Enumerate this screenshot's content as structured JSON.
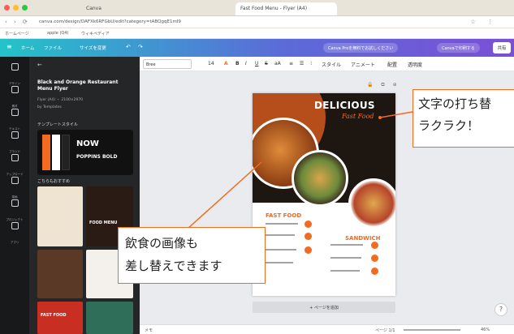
{
  "browser": {
    "tabs": [
      {
        "label": "Canva"
      },
      {
        "label": "Fast Food Menu - Flyer (A4)"
      }
    ],
    "url": "canva.com/design/DAFXk6RFGbU/edit?category=tABQgqE1mI9",
    "bookmarks": [
      "ホームページ",
      "apple (Q4)",
      "ウィキペディア"
    ]
  },
  "header": {
    "items": [
      "ホーム",
      "ファイル",
      "サイズを変更"
    ],
    "right_pills": [
      "Canva Proを無料でお試しください",
      "Canvaで印刷する"
    ],
    "share_label": "共有"
  },
  "toolbar": {
    "font": "Bree",
    "font_size": "14",
    "items": [
      "B",
      "I",
      "U",
      "S",
      "aA",
      "スタイル",
      "アニメート",
      "配置",
      "透明度"
    ]
  },
  "rail": {
    "items": [
      "デザイン",
      "素材",
      "テキスト",
      "ブランド",
      "アップロード",
      "描画",
      "プロジェクト",
      "アプリ"
    ]
  },
  "panel": {
    "back": "←",
    "title": "Black and Orange Restaurant Menu Flyer",
    "meta": "Flyer (A4) ・ 2100×2970",
    "by": "by Templates",
    "style_header": "テンプレートスタイル",
    "style_name": "NOW",
    "style_font": "POPPINS BOLD",
    "more_header": "こちらもおすすめ",
    "thumb_texts": [
      "FOOD MENU",
      "FAST FOOD"
    ]
  },
  "poster": {
    "headline": "DELICIOUS",
    "script": "Fast Food",
    "fast_food": "FAST FOOD",
    "sandwich": "SANDWICH"
  },
  "canvas": {
    "add_page": "+ ページを追加"
  },
  "bottom_bar": {
    "notes": "メモ",
    "pages": "ページ 1/1",
    "zoom": "46%"
  },
  "callouts": {
    "text_edit_line1": "文字の打ち替",
    "text_edit_line2": "ラクラク！",
    "image_line1": "飲食の画像も",
    "image_line2": "差し替えできます"
  }
}
